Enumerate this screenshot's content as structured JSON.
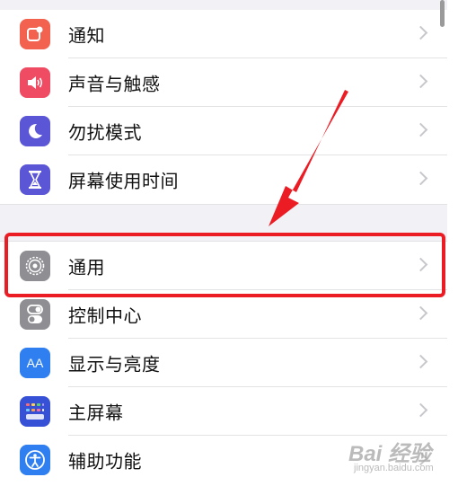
{
  "settings_group_1": [
    {
      "label": "通知",
      "icon": "notifications-icon",
      "color": "#f2624e"
    },
    {
      "label": "声音与触感",
      "icon": "sound-icon",
      "color": "#ef4b62"
    },
    {
      "label": "勿扰模式",
      "icon": "moon-icon",
      "color": "#5b56d6"
    },
    {
      "label": "屏幕使用时间",
      "icon": "hourglass-icon",
      "color": "#5b56d6"
    }
  ],
  "settings_group_2": [
    {
      "label": "通用",
      "icon": "gear-icon",
      "color": "#8e8e93"
    },
    {
      "label": "控制中心",
      "icon": "toggles-icon",
      "color": "#8e8e93"
    },
    {
      "label": "显示与亮度",
      "icon": "display-aa-icon",
      "color": "#2f7ff0",
      "glyph": "AA"
    },
    {
      "label": "主屏幕",
      "icon": "home-screen-icon",
      "color": "#3650d6"
    },
    {
      "label": "辅助功能",
      "icon": "accessibility-icon",
      "color": "#2f7ff0"
    }
  ],
  "annotation": {
    "highlight_color": "#ec1c24"
  },
  "watermark": {
    "main": "Bai 经验",
    "sub": "jingyan.baidu.com"
  }
}
